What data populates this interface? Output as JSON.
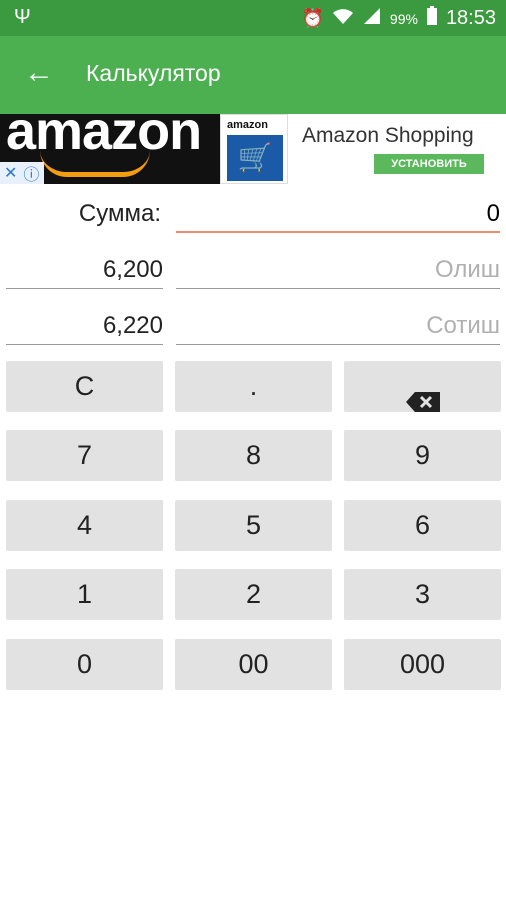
{
  "status_bar": {
    "battery_percent": "99%",
    "time": "18:53"
  },
  "app_bar": {
    "title": "Калькулятор"
  },
  "ad_banner": {
    "brand_text": "amazon",
    "app_icon_label": "amazon",
    "app_name": "Amazon Shopping",
    "install_label": "УСТАНОВИТЬ"
  },
  "fields": {
    "sum_label": "Сумма:",
    "sum_value": "0",
    "olish_value": "6,200",
    "olish_hint": "Олиш",
    "sotish_value": "6,220",
    "sotish_hint": "Сотиш"
  },
  "keypad": {
    "rows": [
      [
        "C",
        ".",
        "backspace"
      ],
      [
        "7",
        "8",
        "9"
      ],
      [
        "4",
        "5",
        "6"
      ],
      [
        "1",
        "2",
        "3"
      ],
      [
        "0",
        "00",
        "000"
      ]
    ]
  }
}
